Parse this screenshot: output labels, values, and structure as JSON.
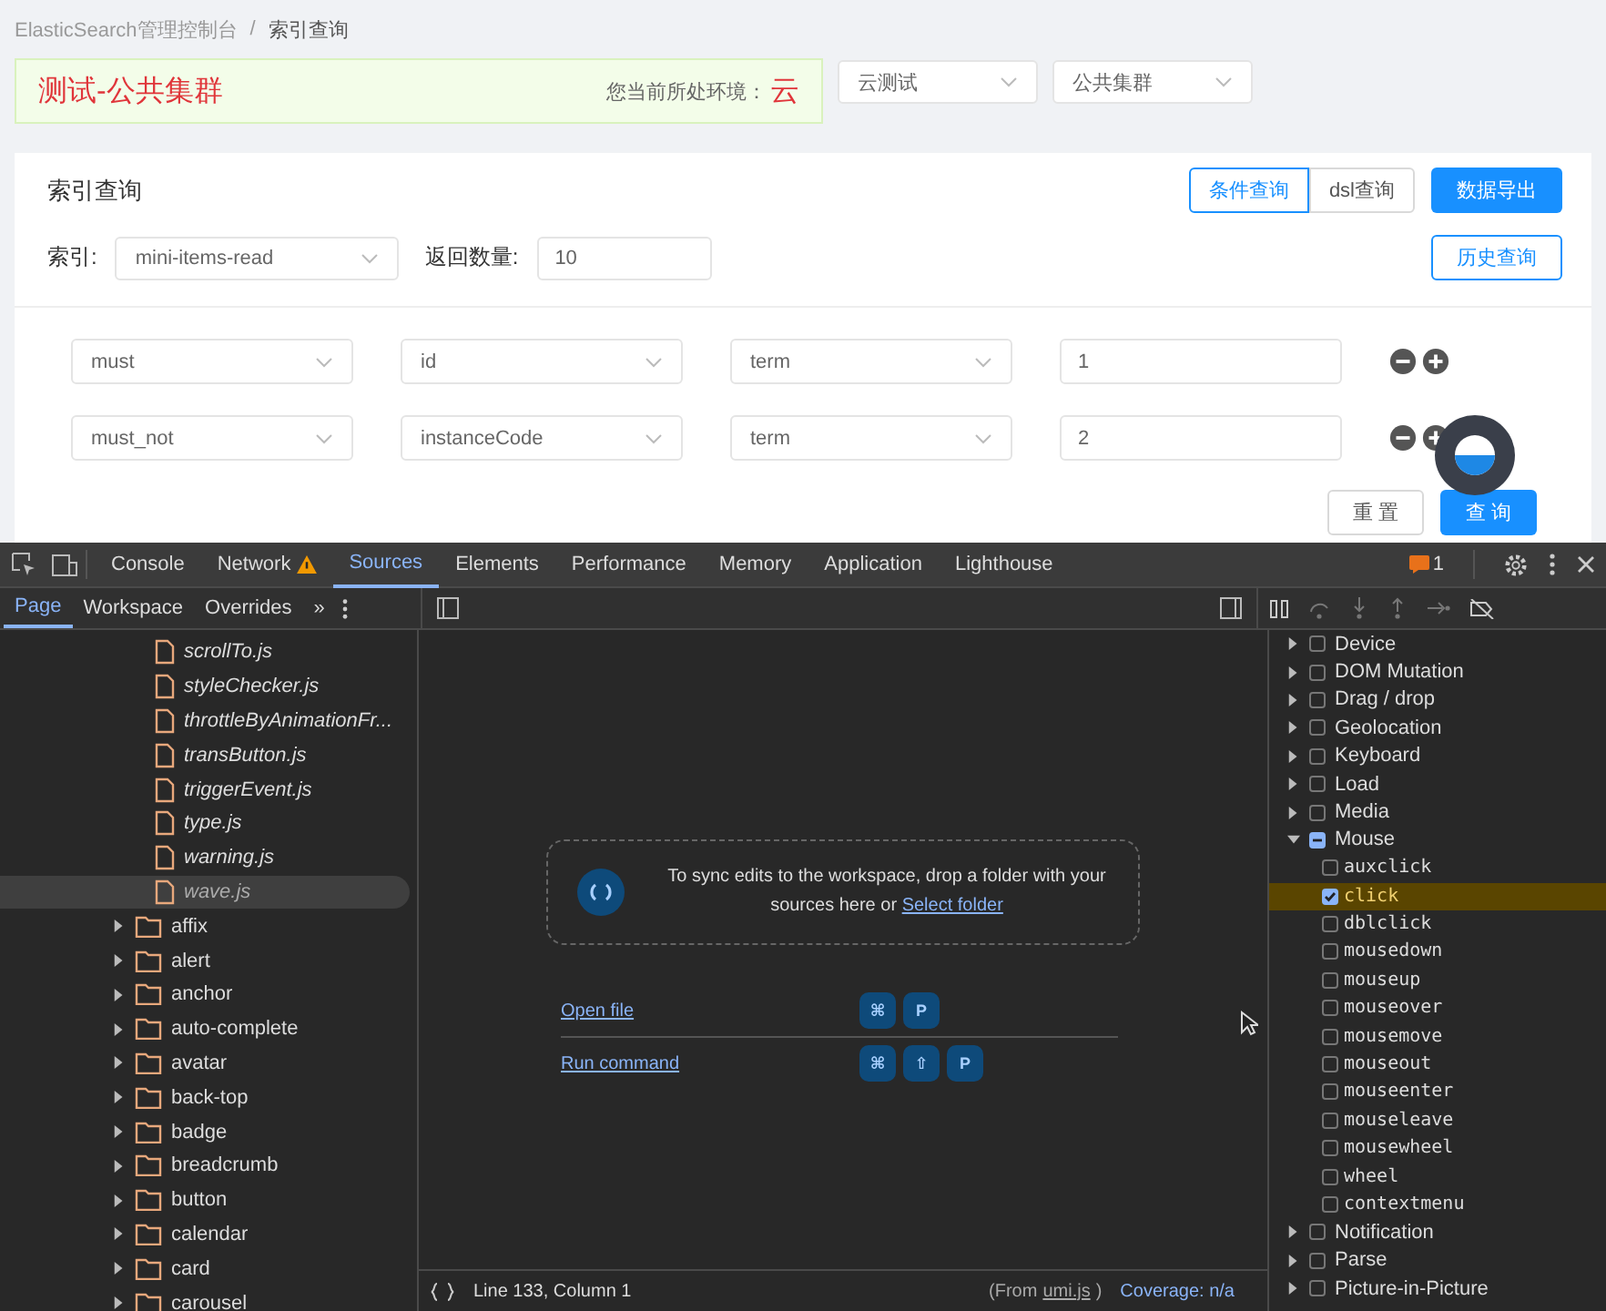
{
  "breadcrumb": {
    "items": [
      "ElasticSearch管理控制台",
      "索引查询"
    ],
    "separator": "/"
  },
  "banner": {
    "title": "测试-公共集群",
    "env_label": "您当前所处环境：",
    "env_value": "云"
  },
  "env_selects": [
    {
      "value": "云测试"
    },
    {
      "value": "公共集群"
    }
  ],
  "panel": {
    "title": "索引查询",
    "mode_tabs": [
      {
        "label": "条件查询",
        "selected": true
      },
      {
        "label": "dsl查询",
        "selected": false
      }
    ],
    "export_button": "数据导出",
    "index_label": "索引:",
    "index_value": "mini-items-read",
    "count_label": "返回数量:",
    "count_value": "10",
    "history_button": "历史查询",
    "conditions": [
      {
        "occur": "must",
        "field": "id",
        "type": "term",
        "value": "1"
      },
      {
        "occur": "must_not",
        "field": "instanceCode",
        "type": "term",
        "value": "2"
      }
    ],
    "reset_button": "重 置",
    "query_button": "查 询"
  },
  "devtools": {
    "tabs": [
      {
        "label": "Console",
        "selected": false,
        "warning": false
      },
      {
        "label": "Network",
        "selected": false,
        "warning": true
      },
      {
        "label": "Sources",
        "selected": true,
        "warning": false
      },
      {
        "label": "Elements",
        "selected": false,
        "warning": false
      },
      {
        "label": "Performance",
        "selected": false,
        "warning": false
      },
      {
        "label": "Memory",
        "selected": false,
        "warning": false
      },
      {
        "label": "Application",
        "selected": false,
        "warning": false
      },
      {
        "label": "Lighthouse",
        "selected": false,
        "warning": false
      }
    ],
    "issues_count": "1",
    "nav_tabs": [
      {
        "label": "Page",
        "selected": true
      },
      {
        "label": "Workspace",
        "selected": false
      },
      {
        "label": "Overrides",
        "selected": false
      }
    ],
    "more_tabs": "»",
    "files": [
      {
        "name": "scrollTo.js",
        "kind": "file",
        "selected": false
      },
      {
        "name": "styleChecker.js",
        "kind": "file",
        "selected": false
      },
      {
        "name": "throttleByAnimationFr...",
        "kind": "file",
        "selected": false
      },
      {
        "name": "transButton.js",
        "kind": "file",
        "selected": false
      },
      {
        "name": "triggerEvent.js",
        "kind": "file",
        "selected": false
      },
      {
        "name": "type.js",
        "kind": "file",
        "selected": false
      },
      {
        "name": "warning.js",
        "kind": "file",
        "selected": false
      },
      {
        "name": "wave.js",
        "kind": "file",
        "selected": true
      },
      {
        "name": "affix",
        "kind": "folder",
        "selected": false
      },
      {
        "name": "alert",
        "kind": "folder",
        "selected": false
      },
      {
        "name": "anchor",
        "kind": "folder",
        "selected": false
      },
      {
        "name": "auto-complete",
        "kind": "folder",
        "selected": false
      },
      {
        "name": "avatar",
        "kind": "folder",
        "selected": false
      },
      {
        "name": "back-top",
        "kind": "folder",
        "selected": false
      },
      {
        "name": "badge",
        "kind": "folder",
        "selected": false
      },
      {
        "name": "breadcrumb",
        "kind": "folder",
        "selected": false
      },
      {
        "name": "button",
        "kind": "folder",
        "selected": false
      },
      {
        "name": "calendar",
        "kind": "folder",
        "selected": false
      },
      {
        "name": "card",
        "kind": "folder",
        "selected": false
      },
      {
        "name": "carousel",
        "kind": "folder",
        "selected": false
      }
    ],
    "sync_text": "To sync edits to the workspace, drop a folder with your sources here or",
    "sync_link": "Select folder",
    "shortcuts": [
      {
        "label": "Open file",
        "keys": [
          "⌘",
          "P"
        ]
      },
      {
        "label": "Run command",
        "keys": [
          "⌘",
          "⇧",
          "P"
        ]
      }
    ],
    "status_position": "Line 133, Column 1",
    "status_from": "(From",
    "status_source": "umi.js",
    "status_from_end": ")",
    "status_coverage": "Coverage: n/a",
    "breakpoints": [
      {
        "label": "Device",
        "expanded": false,
        "checked": false,
        "partial": false
      },
      {
        "label": "DOM Mutation",
        "expanded": false,
        "checked": false,
        "partial": false
      },
      {
        "label": "Drag / drop",
        "expanded": false,
        "checked": false,
        "partial": false
      },
      {
        "label": "Geolocation",
        "expanded": false,
        "checked": false,
        "partial": false
      },
      {
        "label": "Keyboard",
        "expanded": false,
        "checked": false,
        "partial": false
      },
      {
        "label": "Load",
        "expanded": false,
        "checked": false,
        "partial": false
      },
      {
        "label": "Media",
        "expanded": false,
        "checked": false,
        "partial": false
      },
      {
        "label": "Mouse",
        "expanded": true,
        "checked": false,
        "partial": true,
        "children": [
          {
            "label": "auxclick",
            "checked": false,
            "selected": false
          },
          {
            "label": "click",
            "checked": true,
            "selected": true
          },
          {
            "label": "dblclick",
            "checked": false,
            "selected": false
          },
          {
            "label": "mousedown",
            "checked": false,
            "selected": false
          },
          {
            "label": "mouseup",
            "checked": false,
            "selected": false
          },
          {
            "label": "mouseover",
            "checked": false,
            "selected": false
          },
          {
            "label": "mousemove",
            "checked": false,
            "selected": false
          },
          {
            "label": "mouseout",
            "checked": false,
            "selected": false
          },
          {
            "label": "mouseenter",
            "checked": false,
            "selected": false
          },
          {
            "label": "mouseleave",
            "checked": false,
            "selected": false
          },
          {
            "label": "mousewheel",
            "checked": false,
            "selected": false
          },
          {
            "label": "wheel",
            "checked": false,
            "selected": false
          },
          {
            "label": "contextmenu",
            "checked": false,
            "selected": false
          }
        ]
      },
      {
        "label": "Notification",
        "expanded": false,
        "checked": false,
        "partial": false
      },
      {
        "label": "Parse",
        "expanded": false,
        "checked": false,
        "partial": false
      },
      {
        "label": "Picture-in-Picture",
        "expanded": false,
        "checked": false,
        "partial": false
      }
    ]
  }
}
